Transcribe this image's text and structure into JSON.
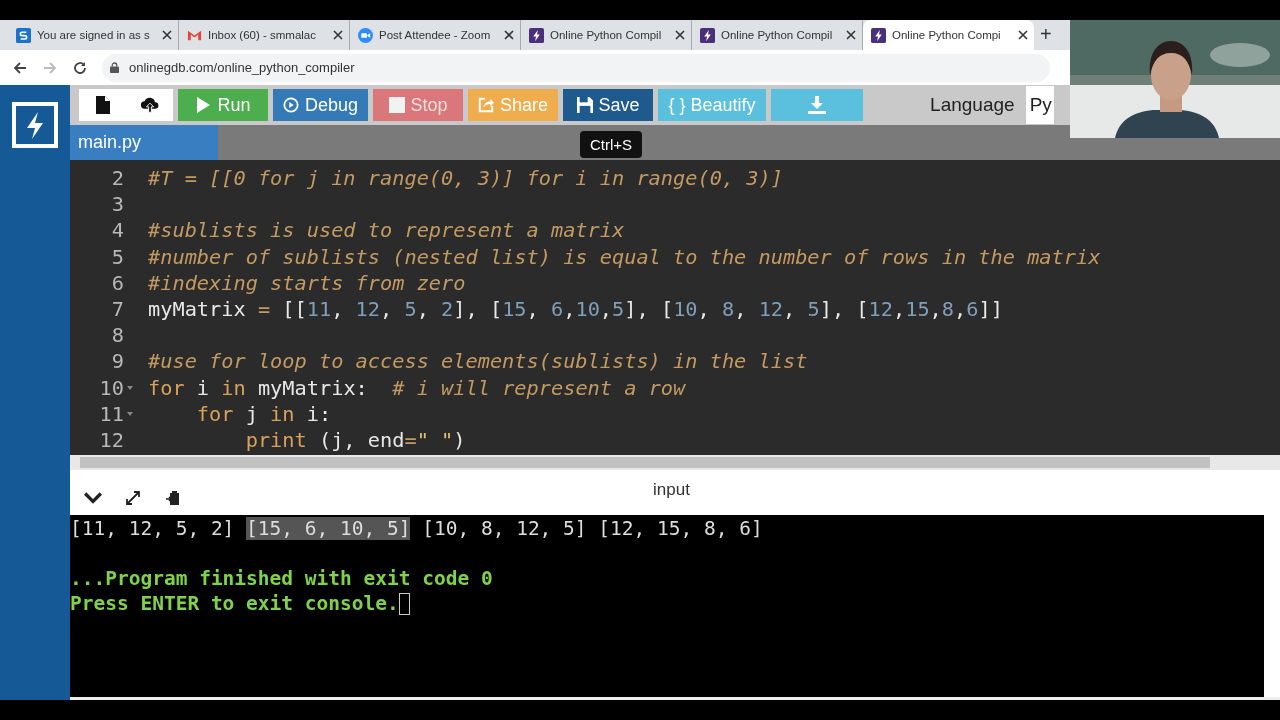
{
  "browser": {
    "tabs": [
      {
        "title": "You are signed in as s",
        "kind": "s-square",
        "selected": false
      },
      {
        "title": "Inbox (60) - smmalac",
        "kind": "mail",
        "selected": false
      },
      {
        "title": "Post Attendee - Zoom",
        "kind": "video",
        "selected": false
      },
      {
        "title": "Online Python Compil",
        "kind": "bolt",
        "selected": false
      },
      {
        "title": "Online Python Compil",
        "kind": "bolt",
        "selected": false
      },
      {
        "title": "Online Python Compi",
        "kind": "bolt",
        "selected": true
      }
    ],
    "new_tab": "+",
    "url": "onlinegdb.com/online_python_compiler"
  },
  "toolbar": {
    "buttons": [
      {
        "label": "Run",
        "kind": "run"
      },
      {
        "label": "Debug",
        "kind": "debug"
      },
      {
        "label": "Stop",
        "kind": "stop"
      },
      {
        "label": "Share",
        "kind": "share"
      },
      {
        "label": "Save",
        "kind": "save"
      },
      {
        "label": "{ } Beautify",
        "kind": "beautify"
      },
      {
        "kind": "download"
      }
    ],
    "tooltip": "Ctrl+S",
    "language_label": "Language",
    "language_value": "Py"
  },
  "file_tab": "main.py",
  "editor": {
    "lines": [
      {
        "number": "2",
        "tokens": [
          {
            "text": "#T = [[0 for j in range(0, 3)] for i in range(0, 3)]",
            "kind": "comment"
          }
        ]
      },
      {
        "number": "3"
      },
      {
        "number": "4",
        "tokens": [
          {
            "text": "#sublists is used to represent a matrix",
            "kind": "comment"
          }
        ]
      },
      {
        "number": "5",
        "tokens": [
          {
            "text": "#number of sublists (nested list) is equal to the number of rows in the matrix",
            "kind": "comment"
          }
        ]
      },
      {
        "number": "6",
        "tokens": [
          {
            "text": "#indexing starts from zero",
            "kind": "comment"
          }
        ]
      },
      {
        "number": "7",
        "tokens": [
          {
            "text": "myMatrix ",
            "kind": "plain"
          },
          {
            "text": "=",
            "kind": "op"
          },
          {
            "text": " [[",
            "kind": "plain"
          },
          {
            "text": "11",
            "kind": "number"
          },
          {
            "text": ", ",
            "kind": "plain"
          },
          {
            "text": "12",
            "kind": "number"
          },
          {
            "text": ", ",
            "kind": "plain"
          },
          {
            "text": "5",
            "kind": "number"
          },
          {
            "text": ", ",
            "kind": "plain"
          },
          {
            "text": "2",
            "kind": "number"
          },
          {
            "text": "],",
            "kind": "plain"
          },
          {
            "text": " [",
            "kind": "plain"
          },
          {
            "text": "15",
            "kind": "number"
          },
          {
            "text": ", ",
            "kind": "plain"
          },
          {
            "text": "6",
            "kind": "number"
          },
          {
            "text": ",",
            "kind": "plain"
          },
          {
            "text": "10",
            "kind": "number"
          },
          {
            "text": ",",
            "kind": "plain"
          },
          {
            "text": "5",
            "kind": "number"
          },
          {
            "text": "], [",
            "kind": "plain"
          },
          {
            "text": "10",
            "kind": "number"
          },
          {
            "text": ", ",
            "kind": "plain"
          },
          {
            "text": "8",
            "kind": "number"
          },
          {
            "text": ", ",
            "kind": "plain"
          },
          {
            "text": "12",
            "kind": "number"
          },
          {
            "text": ", ",
            "kind": "plain"
          },
          {
            "text": "5",
            "kind": "number"
          },
          {
            "text": "], [",
            "kind": "plain"
          },
          {
            "text": "12",
            "kind": "number"
          },
          {
            "text": ",",
            "kind": "plain"
          },
          {
            "text": "15",
            "kind": "number"
          },
          {
            "text": ",",
            "kind": "plain"
          },
          {
            "text": "8",
            "kind": "number"
          },
          {
            "text": ",",
            "kind": "plain"
          },
          {
            "text": "6",
            "kind": "number"
          },
          {
            "text": "]]",
            "kind": "plain"
          }
        ]
      },
      {
        "number": "8"
      },
      {
        "number": "9",
        "tokens": [
          {
            "text": "#use for loop to access elements(sublists) in the list",
            "kind": "comment"
          }
        ]
      },
      {
        "number": "10",
        "tokens": [
          {
            "text": "for",
            "kind": "keyword"
          },
          {
            "text": " i ",
            "kind": "plain"
          },
          {
            "text": "in",
            "kind": "keyword"
          },
          {
            "text": " myMatrix:  ",
            "kind": "plain"
          },
          {
            "text": "# i will represent a row",
            "kind": "comment"
          }
        ],
        "children": [
          {
            "number": "11",
            "tokens": [
              {
                "text": "for",
                "kind": "keyword"
              },
              {
                "text": " j ",
                "kind": "plain"
              },
              {
                "text": "in",
                "kind": "keyword"
              },
              {
                "text": " i:",
                "kind": "plain"
              }
            ],
            "children": [
              {
                "number": "12",
                "tokens": [
                  {
                    "text": "print",
                    "kind": "keyword"
                  },
                  {
                    "text": " (j, end",
                    "kind": "plain"
                  },
                  {
                    "text": "=",
                    "kind": "op"
                  },
                  {
                    "text": "\" \"",
                    "kind": "string"
                  },
                  {
                    "text": ")",
                    "kind": "plain"
                  }
                ]
              }
            ]
          }
        ]
      }
    ]
  },
  "console": {
    "title": "input",
    "output": [
      {
        "text": "[11, 12, 5, 2] ",
        "highlighted": false
      },
      {
        "text": "[15, 6, 10, 5]",
        "highlighted": true
      },
      {
        "text": " [10, 8, 12, 5] [12, 15, 8, 6]",
        "highlighted": false
      }
    ],
    "status_lines": [
      "...Program finished with exit code 0",
      "Press ENTER to exit console."
    ]
  }
}
